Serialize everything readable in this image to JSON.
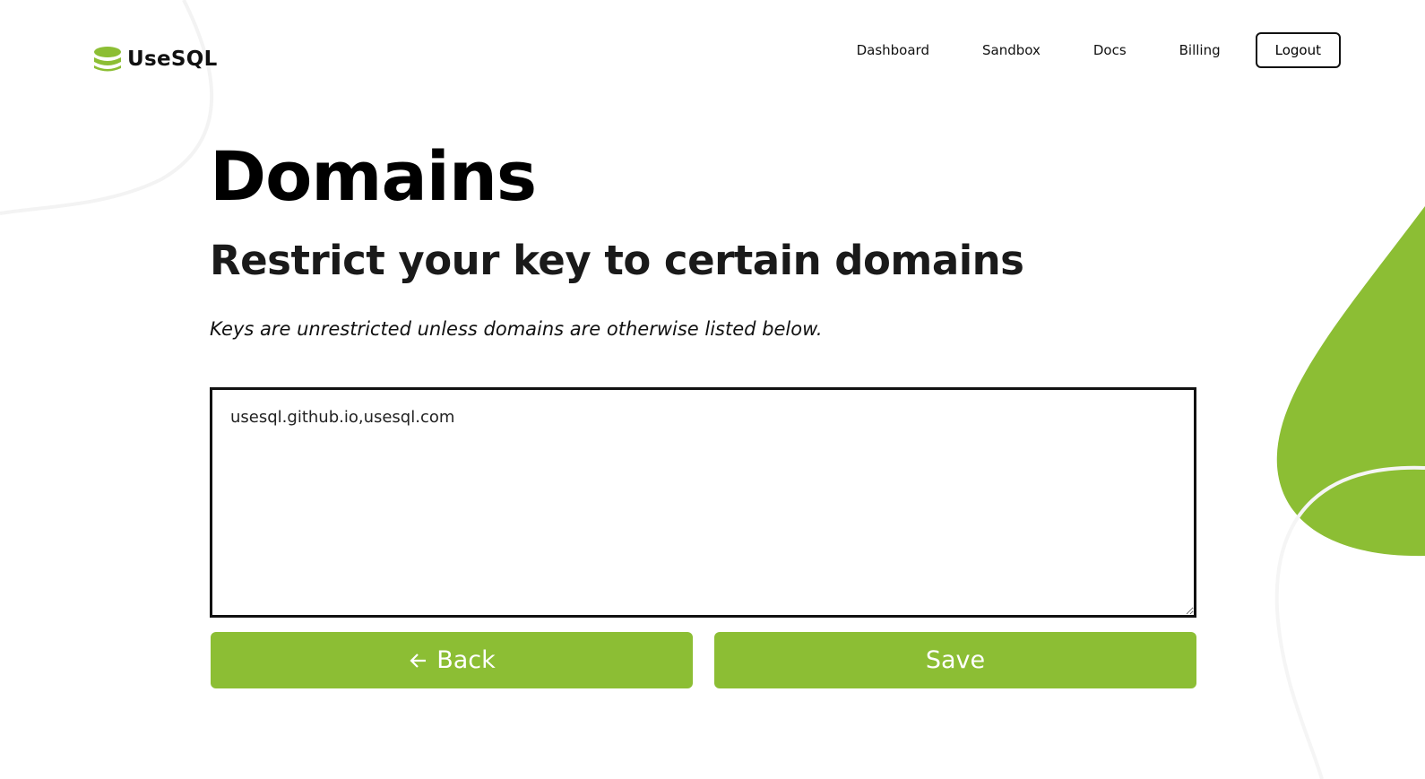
{
  "brand": {
    "name": "UseSQL",
    "accent": "#8cbe34"
  },
  "nav": {
    "items": [
      "Dashboard",
      "Sandbox",
      "Docs",
      "Billing"
    ],
    "logout": "Logout"
  },
  "page": {
    "title": "Domains",
    "subtitle": "Restrict your key to certain domains",
    "note": "Keys are unrestricted unless domains are otherwise listed below.",
    "domains_value": "usesql.github.io,usesql.com",
    "back_label": "Back",
    "back_icon": "arrow-left-icon",
    "save_label": "Save"
  }
}
